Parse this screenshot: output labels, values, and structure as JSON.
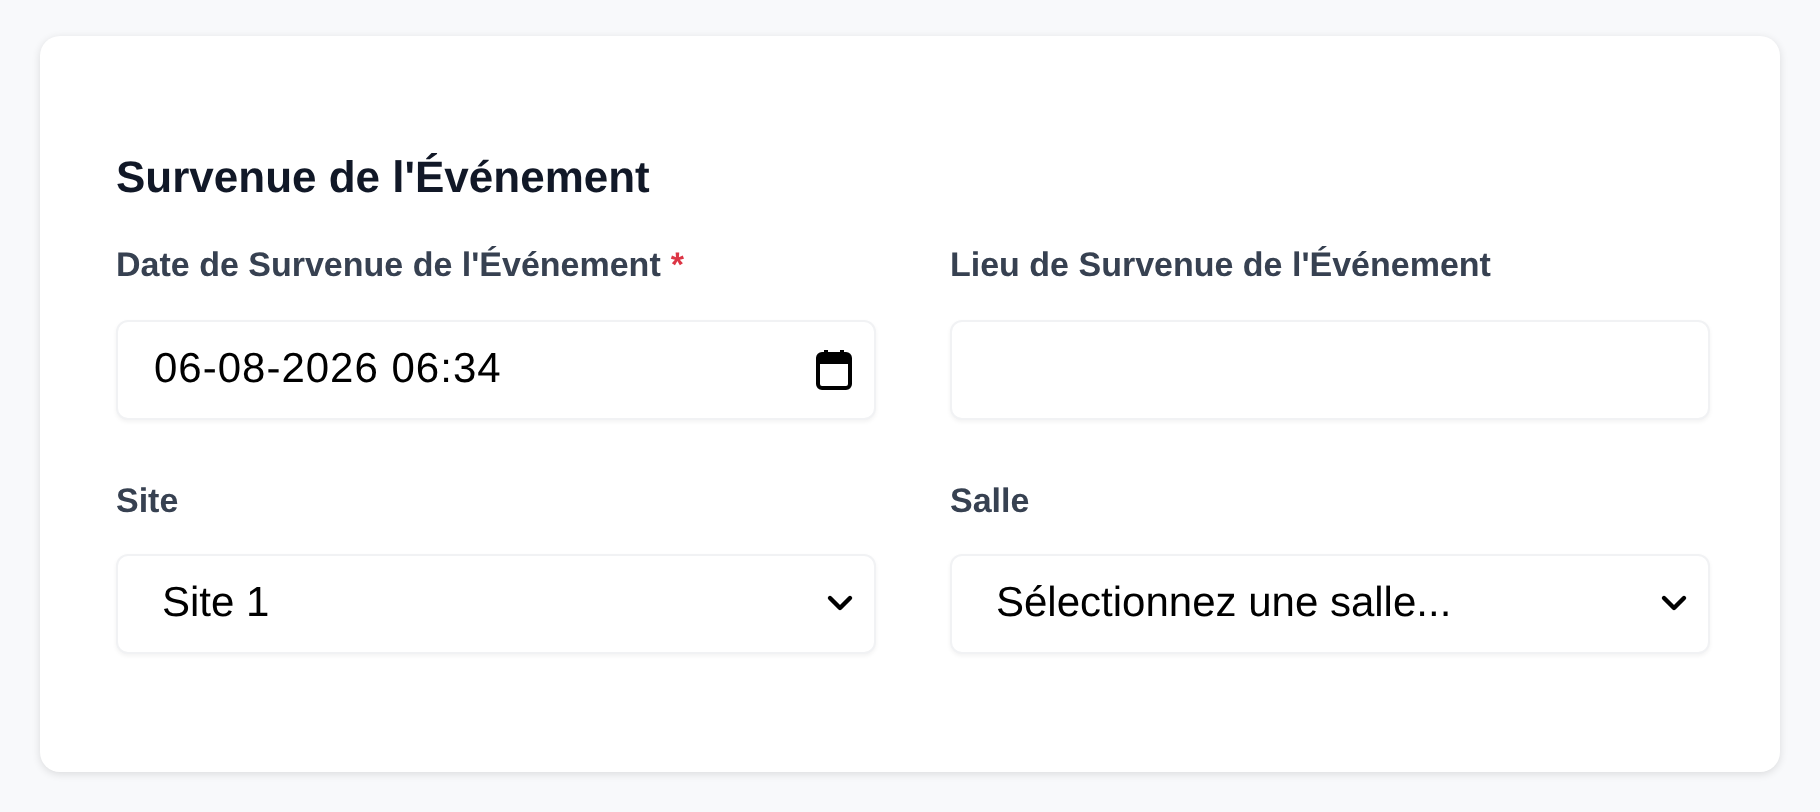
{
  "section": {
    "title": "Survenue de l'Événement"
  },
  "fields": [
    {
      "label": "Date de Survenue de l'Événement",
      "required_mark": "*",
      "kind": "datetime",
      "value": "06-08-2026 06:34"
    },
    {
      "label": "Lieu de Survenue de l'Événement",
      "kind": "text"
    },
    {
      "label": "Site",
      "kind": "select",
      "value": "Site 1"
    },
    {
      "label": "Salle",
      "kind": "select",
      "value": "Sélectionnez une salle..."
    }
  ]
}
